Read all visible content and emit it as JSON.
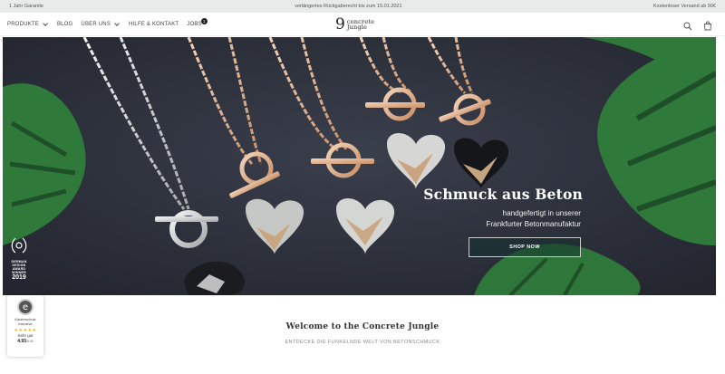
{
  "announcement": {
    "left": "1 Jahr Garantie",
    "center": "verlängertes Rückgaberecht bis zum 15.01.2021",
    "right": "Kostenloser Versand ab 90€"
  },
  "nav": {
    "items": [
      {
        "label": "PRODUKTE",
        "has_dropdown": true
      },
      {
        "label": "BLOG",
        "has_dropdown": false
      },
      {
        "label": "ÜBER UNS",
        "has_dropdown": true
      },
      {
        "label": "HILFE & KONTAKT",
        "has_dropdown": false
      },
      {
        "label": "JOBS",
        "has_dropdown": false,
        "badge": "1"
      }
    ],
    "logo_mark": "9",
    "logo_line1": "concrete",
    "logo_line2": "Jungle",
    "icons": [
      "search-icon",
      "shopping-bag-icon"
    ]
  },
  "hero": {
    "title": "Schmuck aus Beton",
    "subtitle_line1": "handgefertigt in unserer",
    "subtitle_line2": "Frankfurter Betonmanufaktur",
    "cta": "SHOP NOW",
    "award_text": "GERMAN DESIGN AWARD WINNER",
    "award_year": "2019"
  },
  "trust_badge": {
    "seal": "e",
    "label_line1": "Käuferschutz",
    "label_line2": "inklusive",
    "stars": "★★★★★",
    "rating_text": "Sehr gut",
    "score": "4.93",
    "score_max": "/5.00"
  },
  "welcome": {
    "title": "Welcome to the Concrete Jungle",
    "subtitle": "ENTDECKE DIE FUNKELNDE WELT VON BETONSCHMUCK"
  },
  "colors": {
    "topbar_bg": "#e8ebe9",
    "hero_bg": "#2b2f3a",
    "leaf_green": "#2f7a3a",
    "cta_border": "#c9c9c9"
  }
}
